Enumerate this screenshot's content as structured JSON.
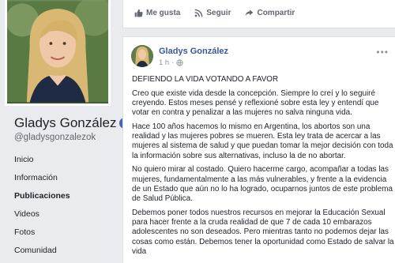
{
  "profile": {
    "name": "Gladys González",
    "handle": "@gladysgonzalezok",
    "nav": [
      "Inicio",
      "Información",
      "Publicaciones",
      "Videos",
      "Fotos",
      "Comunidad"
    ],
    "active_index": 2
  },
  "prev_post_actions": {
    "like_label": "Me gusta",
    "follow_label": "Seguir",
    "share_label": "Compartir"
  },
  "post": {
    "author": "Gladys González",
    "time": "1 h",
    "paragraphs": [
      "DEFIENDO LA VIDA VOTANDO A FAVOR",
      "Creo que existe vida desde la concepción. Siempre lo creí y lo seguiré creyendo. Estos meses pensé y reflexioné sobre esta ley y entendí que votar en contra y penalizar a las mujeres no salva ninguna vida.",
      "Hace 100 años hacemos lo mismo en Argentina, los abortos son una realidad y las mujeres pobres se mueren. Esta ley trata de acercar a las mujeres al sistema de salud y que puedan tomar la mejor decisión con toda la información sobre sus alternativas, incluso la de no abortar.",
      "No quiero mirar al costado. Quiero hacerme cargo, acompañar a todas las mujeres, fundamentalmente a las más vulnerables, y frente a la evidencia de un Estado que aún no lo ha logrado, ocuparnos juntos de este problema de Salud Pública.",
      "Debemos poner todos nuestros recursos en mejorar la Educación Sexual para hacer frente a la cruda realidad de que 7 de cada 10 embarazos adolescentes no son deseados. Pero mientras tanto no podemos dejar las cosas como están. Debemos tener la oportunidad como Estado de salvar la vida"
    ]
  },
  "colors": {
    "page_bg": "#e9ebee",
    "link": "#385898",
    "verified": "#4267b2"
  }
}
